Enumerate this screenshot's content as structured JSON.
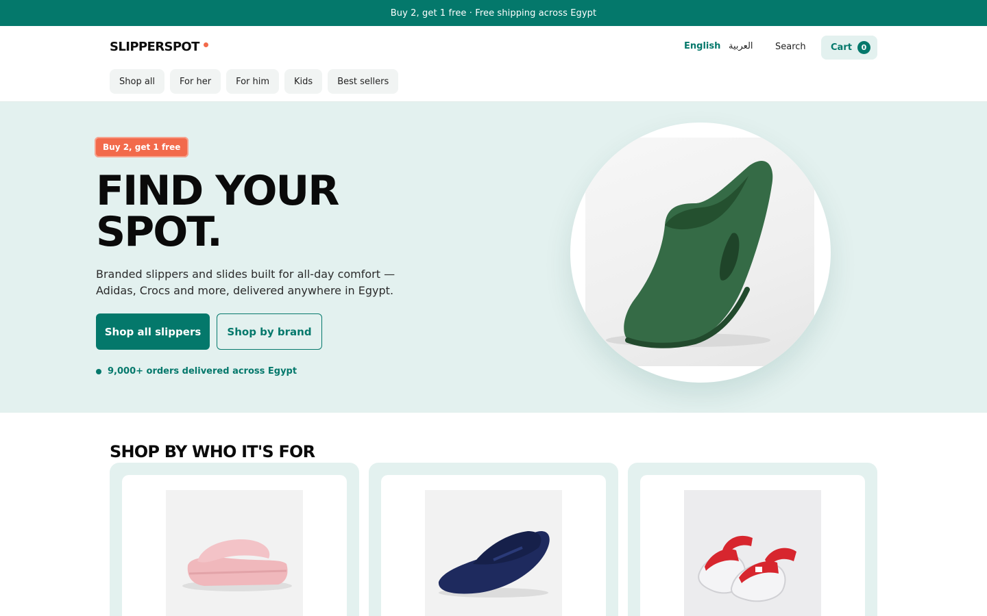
{
  "promo": {
    "text": "Buy 2, get 1 free · Free shipping across Egypt"
  },
  "header": {
    "logo": "SLIPPERSPOT",
    "lang_en": "English",
    "lang_ar": "العربية",
    "search_label": "Search",
    "cart_label": "Cart",
    "cart_count": "0"
  },
  "nav": {
    "items": [
      {
        "label": "Shop all"
      },
      {
        "label": "For her"
      },
      {
        "label": "For him"
      },
      {
        "label": "Kids"
      },
      {
        "label": "Best sellers"
      }
    ]
  },
  "hero": {
    "badge": "Buy 2, get 1 free",
    "title_line1": "FIND YOUR",
    "title_line2": "SPOT.",
    "subtitle": "Branded slippers and slides built for all-day comfort — Adidas, Crocs and more, delivered anywhere in Egypt.",
    "primary_cta": "Shop all slippers",
    "secondary_cta": "Shop by brand",
    "trust_text": "9,000+ orders delivered across Egypt"
  },
  "categories": {
    "title": "SHOP BY WHO IT'S FOR"
  },
  "colors": {
    "brand": "#04786b",
    "accent": "#f26a4b",
    "tint": "#e3f1ef"
  }
}
